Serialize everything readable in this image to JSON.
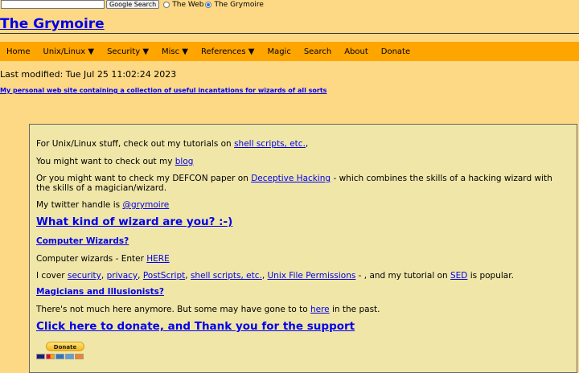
{
  "search": {
    "placeholder": "",
    "button_label": "Google Search",
    "options": [
      {
        "label": "The Web",
        "checked": false
      },
      {
        "label": "The Grymoire",
        "checked": true
      }
    ]
  },
  "site": {
    "title": "The Grymoire"
  },
  "nav": {
    "items": [
      "Home",
      "Unix/Linux ▼",
      "Security ▼",
      "Misc ▼",
      "References ▼",
      "Magic",
      "Search",
      "About",
      "Donate"
    ]
  },
  "meta": {
    "last_modified": "Last modified: Tue Jul 25 11:02:24 2023",
    "tagline": "My personal web site containing a collection of useful incantations for wizards of all sorts"
  },
  "content": {
    "unix_prefix": "For Unix/Linux stuff, check out my tutorials on ",
    "unix_link": "shell scripts, etc.",
    "unix_suffix": ",",
    "blog_prefix": "You might want to check out my ",
    "blog_link": "blog",
    "defcon_prefix": "Or you might want to check my DEFCON paper on ",
    "defcon_link": "Deceptive Hacking",
    "defcon_suffix": " - which combines the skills of a hacking wizard with the skills of a magician/wizard.",
    "twitter_prefix": "My twitter handle is ",
    "twitter_link": "@grymoire",
    "wizard_heading": "What kind of wizard are you? :-)",
    "computer_heading": "Computer Wizards?",
    "computer_prefix": "Computer wizards - Enter ",
    "computer_link": "HERE",
    "cover_prefix": "I cover ",
    "cover_links": [
      "security",
      "privacy",
      "PostScript",
      "shell scripts, etc.",
      "Unix File Permissions"
    ],
    "cover_mid": " - , and my tutorial on ",
    "sed_link": "SED",
    "cover_suffix": " is popular.",
    "magicians_heading": "Magicians and Illusionists?",
    "magicians_prefix": "There's not much here anymore. But some may have gone to to ",
    "magicians_link": "here",
    "magicians_suffix": " in the past.",
    "donate_heading": "Click here to donate, and Thank you for the support",
    "donate_button": "Donate"
  },
  "colors": {
    "page_bg": "#fdd985",
    "nav_bg": "#ffa500",
    "content_bg": "#f0e6a8",
    "link": "#0000ee"
  }
}
